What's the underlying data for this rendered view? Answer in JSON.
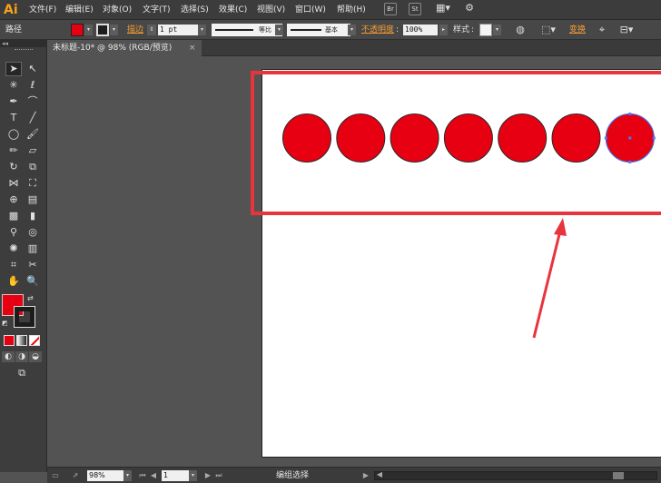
{
  "app": {
    "logo": "Ai",
    "menus": [
      "文件(F)",
      "编辑(E)",
      "对象(O)",
      "文字(T)",
      "选择(S)",
      "效果(C)",
      "视图(V)",
      "窗口(W)",
      "帮助(H)"
    ],
    "menubar_icons": [
      "Br",
      "St"
    ]
  },
  "control": {
    "object_type": "路径",
    "stroke_label": "描边",
    "stroke_weight": "1 pt",
    "stroke_profile": "等比",
    "brush_label": "基本",
    "opacity_label": "不透明度",
    "opacity_value": "100%",
    "style_label": "样式",
    "transform_label": "变换",
    "fill_color": "#e60012"
  },
  "document": {
    "tab_title": "未标题-10* @ 98% (RGB/预览)",
    "tab_close": "×"
  },
  "canvas": {
    "circle_fill": "#e60012",
    "circle_count": 7,
    "highlight_color": "#e8343c"
  },
  "toolbar": {
    "fill_color": "#e60012"
  },
  "status": {
    "zoom": "98%",
    "page": "1",
    "selection_tool": "编组选择"
  }
}
